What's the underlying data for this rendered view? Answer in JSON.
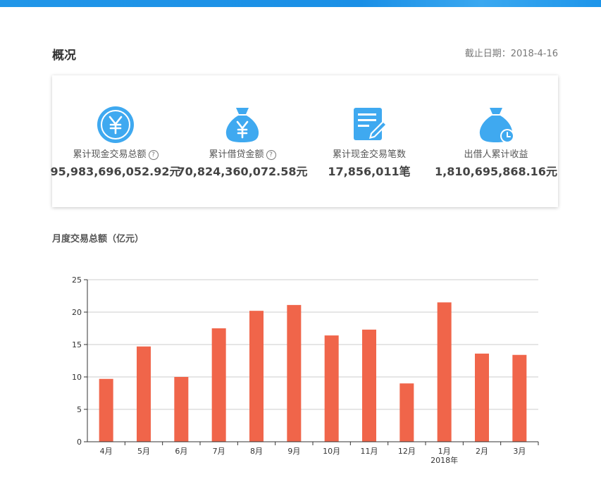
{
  "page": {
    "title": "概况",
    "cutoff_date": "截止日期：2018-4-16"
  },
  "stats": [
    {
      "label": "累计现金交易总额",
      "has_help": true,
      "value": "95,983,696,052.92元",
      "icon": "yen-coin-icon"
    },
    {
      "label": "累计借贷金额",
      "has_help": true,
      "value": "70,824,360,072.58元",
      "icon": "money-bag-icon"
    },
    {
      "label": "累计现金交易笔数",
      "has_help": false,
      "value": "17,856,011笔",
      "icon": "document-edit-icon"
    },
    {
      "label": "出借人累计收益",
      "has_help": false,
      "value": "1,810,695,868.16元",
      "icon": "money-bag-clock-icon"
    }
  ],
  "help_glyph": "?",
  "colors": {
    "accent": "#2196e8",
    "icon_blue": "#3fa9f0",
    "bar": "#f0654a",
    "grid": "#cccccc"
  },
  "chart_data": {
    "type": "bar",
    "title": "月度交易总额（亿元）",
    "categories": [
      "4月",
      "5月",
      "6月",
      "7月",
      "8月",
      "9月",
      "10月",
      "11月",
      "12月",
      "1月",
      "2月",
      "3月"
    ],
    "year_marker": {
      "category": "1月",
      "label": "2018年"
    },
    "values": [
      9.7,
      14.7,
      10.0,
      17.5,
      20.2,
      21.1,
      16.4,
      17.3,
      9.0,
      21.5,
      13.6,
      13.4
    ],
    "ylim": [
      0,
      25
    ],
    "yticks": [
      0,
      5,
      10,
      15,
      20,
      25
    ],
    "grid": true,
    "xlabel": "",
    "ylabel": ""
  }
}
